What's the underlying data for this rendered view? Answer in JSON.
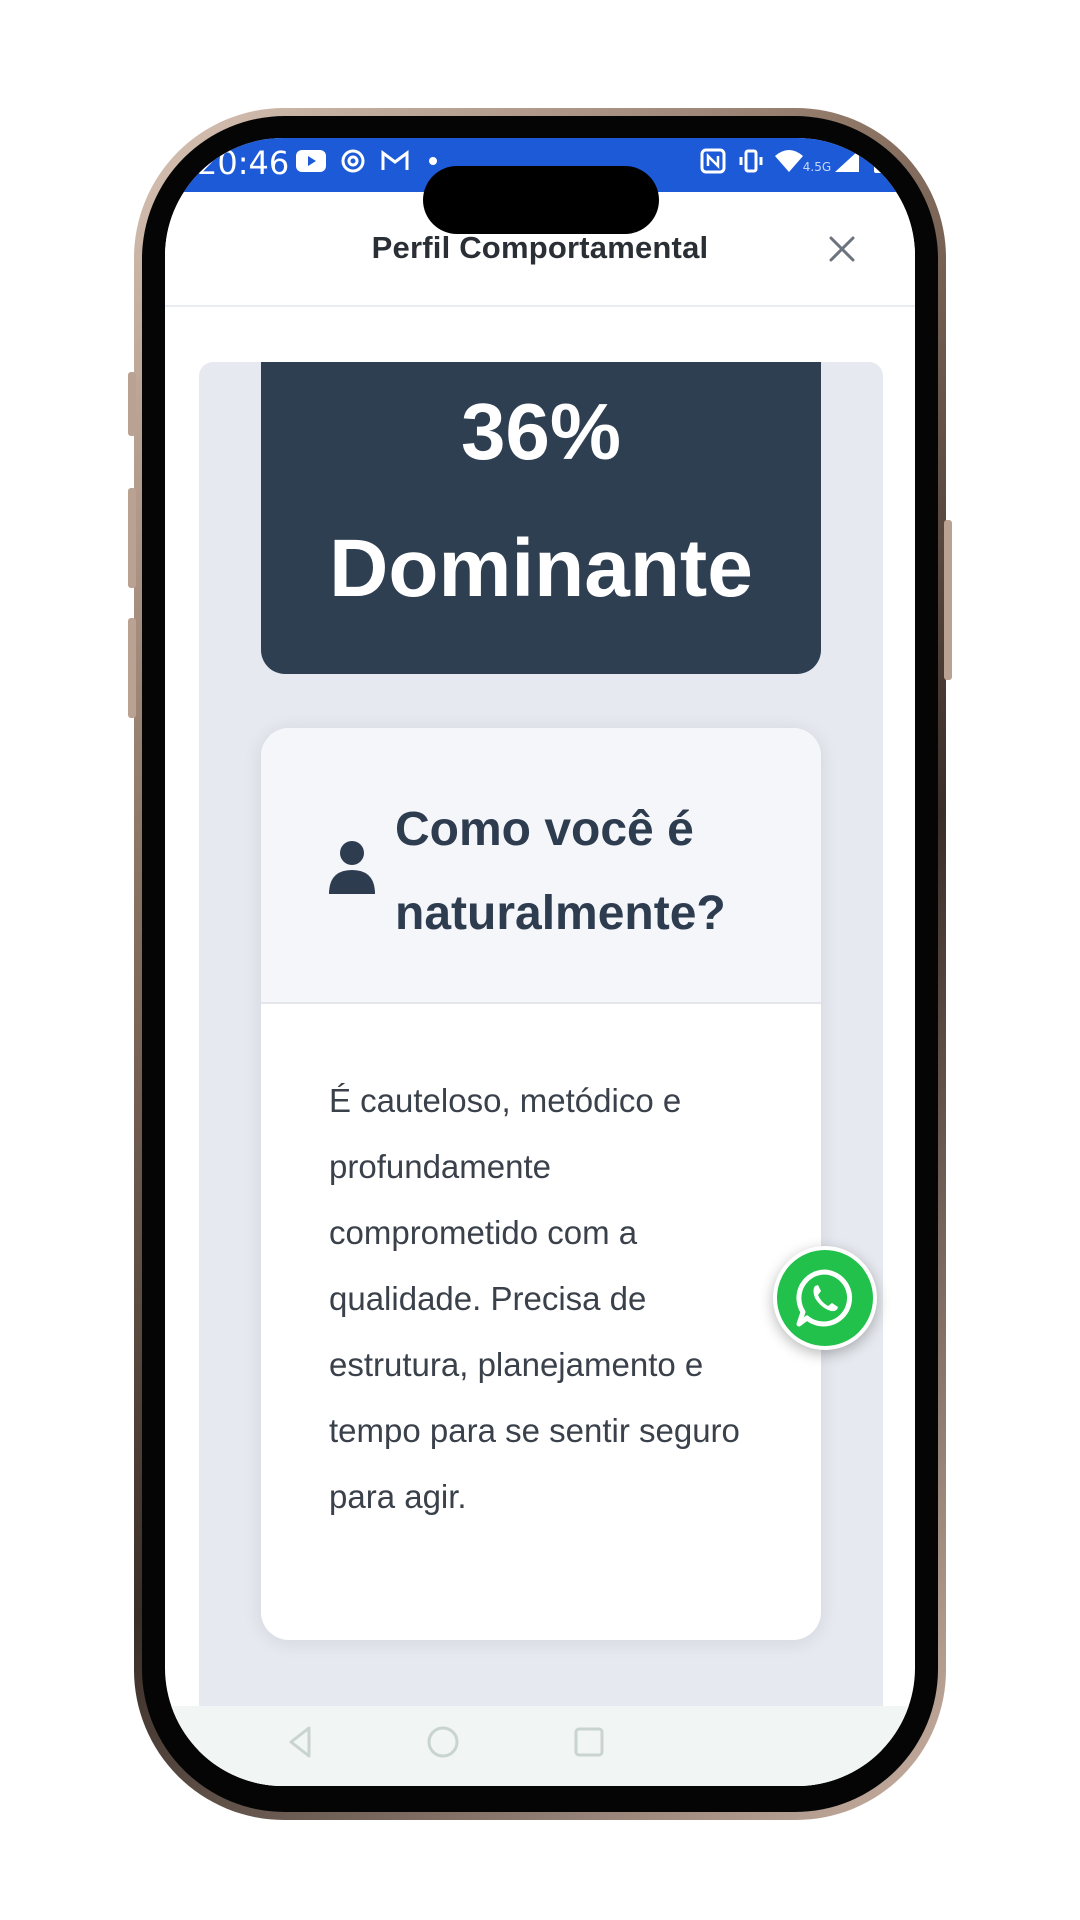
{
  "status_bar": {
    "time": "20:46",
    "icons": [
      "youtube-icon",
      "openai-icon",
      "gmail-icon",
      "dot-icon",
      "nfc-icon",
      "vibrate-icon",
      "wifi-icon",
      "signal-icon",
      "battery-icon"
    ],
    "network": "4.5G"
  },
  "header": {
    "title": "Perfil Comportamental"
  },
  "result": {
    "percent": "36%",
    "profile": "Dominante"
  },
  "info_card": {
    "question": "Como você é naturalmente?",
    "description": "É cauteloso, metódico e profundamente comprometido com a qualidade. Precisa de estrutura, planejamento e tempo para se sentir seguro para agir."
  },
  "colors": {
    "status_bar": "#1d5ad8",
    "result_card": "#2f3f52",
    "question_text": "#2e3c50",
    "whatsapp": "#21c14b"
  }
}
